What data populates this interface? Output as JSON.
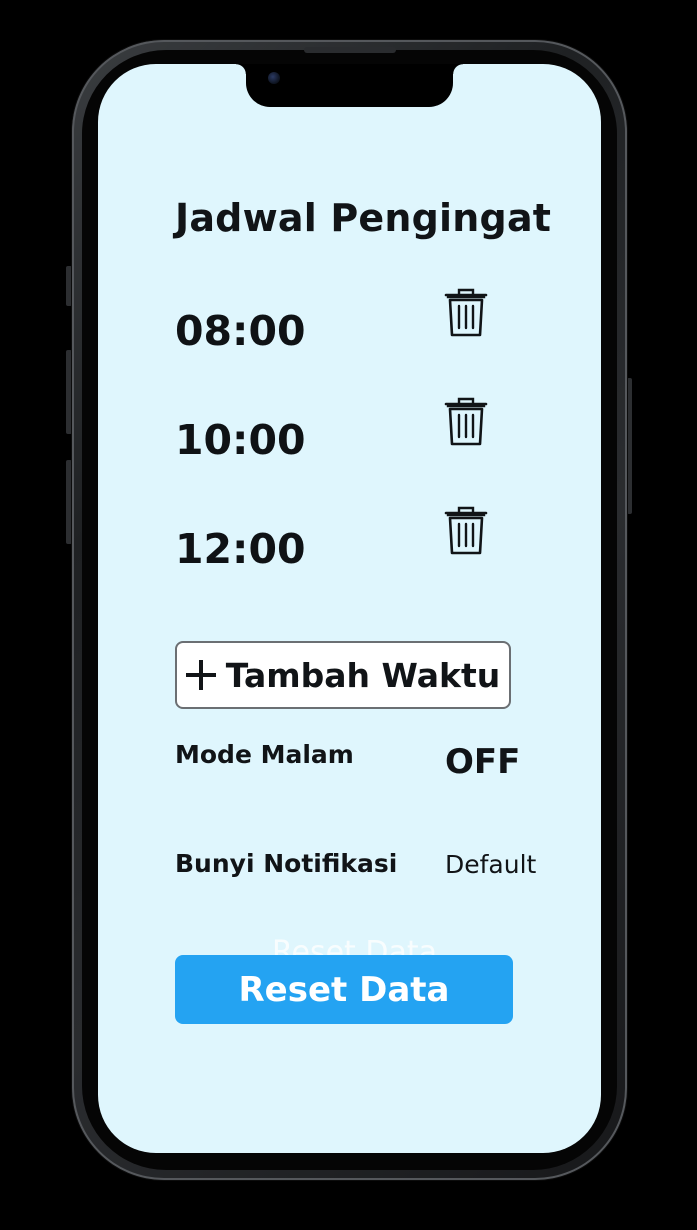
{
  "screen": {
    "title": "Jadwal Pengingat",
    "reminders": [
      {
        "time": "08:00",
        "delete_icon": "trash-icon"
      },
      {
        "time": "10:00",
        "delete_icon": "trash-icon"
      },
      {
        "time": "12:00",
        "delete_icon": "trash-icon"
      }
    ],
    "add_button": {
      "icon": "plus-icon",
      "label": "Tambah Waktu"
    },
    "settings": {
      "night_mode": {
        "label": "Mode Malam",
        "value": "OFF"
      },
      "notification_sound": {
        "label": "Bunyi Notifikasi",
        "value": "Default"
      }
    },
    "reset": {
      "ghost_label": "Reset Data",
      "label": "Reset Data"
    }
  },
  "colors": {
    "screen_background": "#dff6fd",
    "reset_button": "#24a3f2",
    "text": "#111417"
  }
}
